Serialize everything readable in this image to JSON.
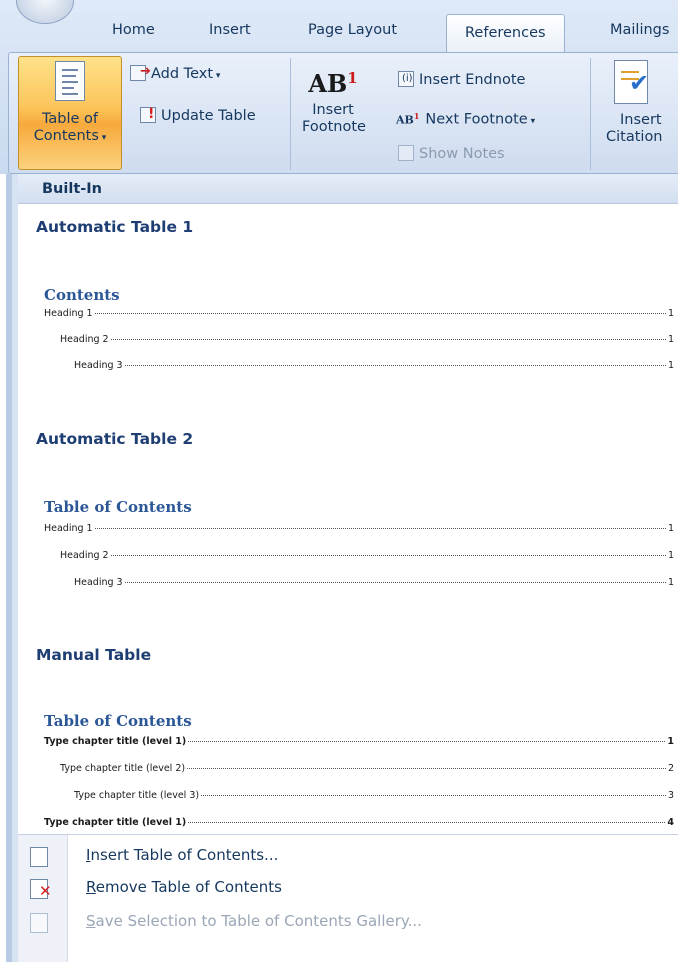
{
  "ribbon": {
    "tabs": [
      "Home",
      "Insert",
      "Page Layout",
      "References",
      "Mailings"
    ],
    "active_tab": "References",
    "toc_button": {
      "line1": "Table of",
      "line2": "Contents"
    },
    "add_text": "Add Text",
    "update_table": "Update Table",
    "insert_footnote": {
      "line1": "Insert",
      "line2": "Footnote"
    },
    "ab_icon_text": "AB",
    "ab_superscript": "1",
    "insert_endnote": "Insert Endnote",
    "next_footnote": "Next Footnote",
    "show_notes": "Show Notes",
    "insert_citation": {
      "line1": "Insert",
      "line2": "Citation"
    }
  },
  "gallery": {
    "header": "Built-In",
    "sections": [
      {
        "title": "Automatic Table 1",
        "toc_heading": "Contents",
        "entries": [
          {
            "text": "Heading 1",
            "page": "1",
            "level": 1,
            "bold": false
          },
          {
            "text": "Heading 2",
            "page": "1",
            "level": 2,
            "bold": false
          },
          {
            "text": "Heading 3",
            "page": "1",
            "level": 3,
            "bold": false
          }
        ]
      },
      {
        "title": "Automatic Table 2",
        "toc_heading": "Table of Contents",
        "entries": [
          {
            "text": "Heading 1",
            "page": "1",
            "level": 1,
            "bold": false
          },
          {
            "text": "Heading 2",
            "page": "1",
            "level": 2,
            "bold": false
          },
          {
            "text": "Heading 3",
            "page": "1",
            "level": 3,
            "bold": false
          }
        ]
      },
      {
        "title": "Manual Table",
        "toc_heading": "Table of Contents",
        "entries": [
          {
            "text": "Type chapter title (level 1)",
            "page": "1",
            "level": 1,
            "bold": true
          },
          {
            "text": "Type chapter title (level 2)",
            "page": "2",
            "level": 2,
            "bold": false
          },
          {
            "text": "Type chapter title (level 3)",
            "page": "3",
            "level": 3,
            "bold": false
          },
          {
            "text": "Type chapter title (level 1)",
            "page": "4",
            "level": 1,
            "bold": true
          }
        ]
      }
    ]
  },
  "menu": {
    "items": [
      {
        "accel": "I",
        "rest": "nsert Table of Contents...",
        "icon": "insert-toc-icon",
        "enabled": true
      },
      {
        "accel": "R",
        "rest": "emove Table of Contents",
        "icon": "remove-toc-icon",
        "enabled": true
      },
      {
        "accel": "S",
        "rest": "ave Selection to Table of Contents Gallery...",
        "icon": "save-selection-icon",
        "enabled": false
      }
    ]
  }
}
